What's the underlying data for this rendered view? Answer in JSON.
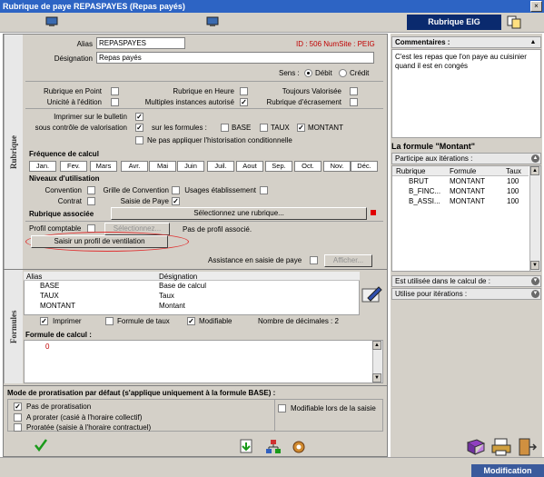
{
  "window": {
    "title": "Rubrique de paye REPASPAYES (Repas payés)",
    "close_glyph": "×"
  },
  "toolbar": {
    "eig_button": "Rubrique EIG"
  },
  "rubrique": {
    "side_label": "Rubrique",
    "alias_label": "Alias",
    "alias_value": "REPASPAYES",
    "id_text": "ID : 506 NumSite : PEIG",
    "designation_label": "Désignation",
    "designation_value": "Repas payés",
    "sens_label": "Sens :",
    "debit_label": "Débit",
    "credit_label": "Crédit",
    "rubrique_en_point": "Rubrique en Point",
    "rubrique_en_heure": "Rubrique en Heure",
    "toujours_valorisee": "Toujours Valorisée",
    "unicite": "Unicité à l'édition",
    "multiples_instances": "Multiples instances autorisé",
    "rubrique_ecrasement": "Rubrique d'écrasement",
    "imprimer_bulletin": "Imprimer sur le bulletin",
    "sous_controle": "sous contrôle de valorisation",
    "sur_formules": "sur les formules :",
    "f_base": "BASE",
    "f_taux": "TAUX",
    "f_montant": "MONTANT",
    "no_historisation": "Ne pas appliquer l'historisation conditionnelle",
    "frequence_title": "Fréquence de calcul",
    "months": [
      "Jan.",
      "Fev.",
      "Mars",
      "Avr.",
      "Mai",
      "Juin",
      "Juil.",
      "Aout",
      "Sep.",
      "Oct.",
      "Nov.",
      "Déc."
    ],
    "niveaux_title": "Niveaux d'utilisation",
    "convention": "Convention",
    "grille_convention": "Grille de Convention",
    "usages_etablissement": "Usages établissement",
    "contrat": "Contrat",
    "saisie_paye": "Saisie de Paye",
    "rubrique_associee_title": "Rubrique associée",
    "select_rubrique_btn": "Sélectionnez une rubrique...",
    "profil_comptable": "Profil comptable",
    "selectionnez_btn": "Sélectionnez...",
    "pas_profil": "Pas de profil associé.",
    "saisir_profil_btn": "Saisir un profil de ventilation",
    "assistance": "Assistance en saisie de paye",
    "afficher_btn": "Afficher..."
  },
  "formules": {
    "side_label": "Formules",
    "col_alias": "Alias",
    "col_designation": "Désignation",
    "rows": [
      {
        "alias": "BASE",
        "designation": "Base de calcul"
      },
      {
        "alias": "TAUX",
        "designation": "Taux"
      },
      {
        "alias": "MONTANT",
        "designation": "Montant"
      }
    ],
    "imprimer": "Imprimer",
    "formule_taux": "Formule de taux",
    "modifiable": "Modifiable",
    "nb_decimales": "Nombre de décimales : 2",
    "formule_calcul_label": "Formule de calcul :",
    "formule_calcul_value": "0"
  },
  "proratisation": {
    "title": "Mode de proratisation par défaut (s'applique uniquement à la formule BASE) :",
    "pas_proratisation": "Pas de proratisation",
    "a_prorater": "A prorater (casié à l'horaire collectif)",
    "proratee": "Proratée (saisie à l'horaire contractuel)",
    "modifiable_saisie": "Modifiable lors de la saisie"
  },
  "right": {
    "commentaires_title": "Commentaires :",
    "commentaires_text": "C'est les repas que l'on paye au cuisinier quand il est en congés",
    "formule_montant_title": "La formule \"Montant\"",
    "participe_title": "Participe aux itérations :",
    "iter_cols": [
      "Rubrique",
      "Formule",
      "Taux"
    ],
    "iter_rows": [
      {
        "rubrique": "BRUT",
        "formule": "MONTANT",
        "taux": "100"
      },
      {
        "rubrique": "B_FINC...",
        "formule": "MONTANT",
        "taux": "100"
      },
      {
        "rubrique": "B_ASSI...",
        "formule": "MONTANT",
        "taux": "100"
      }
    ],
    "utilisee_calcul": "Est utilisée dans le calcul de :",
    "utilise_iterations": "Utilise pour itérations :"
  },
  "status": {
    "mode": "Modification"
  },
  "colors": {
    "title_blue": "#2d64c4",
    "eig_navy": "#0a2a6e",
    "highlight_red": "#e03030"
  }
}
